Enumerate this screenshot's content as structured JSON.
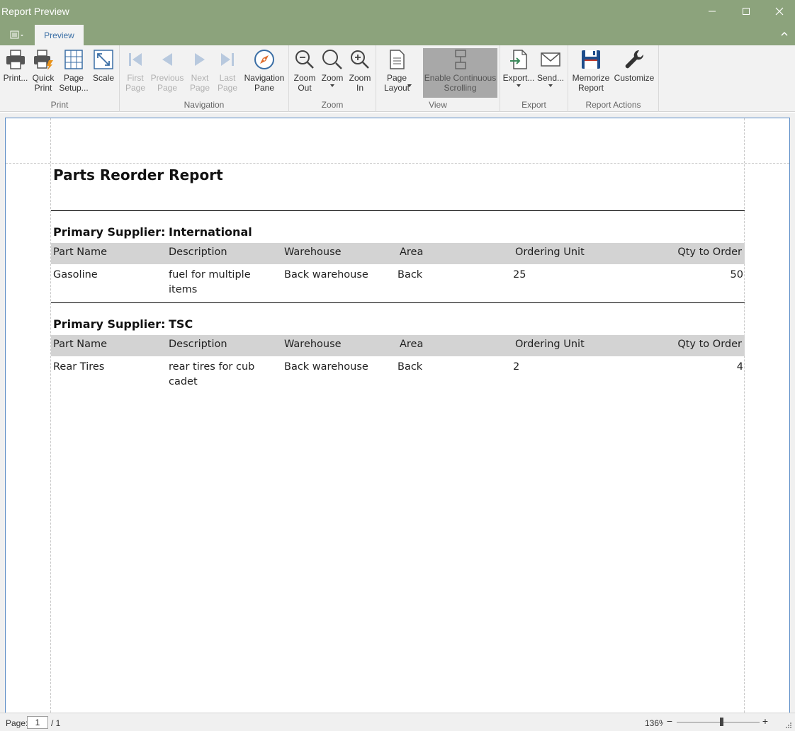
{
  "window": {
    "title": "Report Preview"
  },
  "tabs": {
    "preview": "Preview"
  },
  "ribbon": {
    "groups": {
      "print": "Print",
      "navigation": "Navigation",
      "zoom": "Zoom",
      "view": "View",
      "export": "Export",
      "report_actions": "Report Actions"
    },
    "buttons": {
      "print": "Print...",
      "quick_print": "Quick\nPrint",
      "page_setup": "Page\nSetup...",
      "scale": "Scale",
      "first_page": "First\nPage",
      "previous_page": "Previous\nPage",
      "next_page": "Next\nPage",
      "last_page": "Last\nPage",
      "navigation_pane": "Navigation\nPane",
      "zoom_out": "Zoom\nOut",
      "zoom": "Zoom",
      "zoom_in": "Zoom\nIn",
      "page_layout": "Page\nLayout",
      "continuous_scrolling": "Enable Continuous\nScrolling",
      "export": "Export...",
      "send": "Send...",
      "memorize_report": "Memorize\nReport",
      "customize": "Customize"
    },
    "icons": {
      "print": "printer-icon",
      "quick_print": "quick-print-icon",
      "page_setup": "page-setup-grid-icon",
      "scale": "scale-arrows-icon",
      "first_page": "first-page-icon",
      "previous_page": "previous-page-icon",
      "next_page": "next-page-icon",
      "last_page": "last-page-icon",
      "navigation_pane": "compass-icon",
      "zoom_out": "zoom-out-icon",
      "zoom": "magnifier-icon",
      "zoom_in": "zoom-in-icon",
      "page_layout": "page-layout-icon",
      "continuous_scrolling": "continuous-scrolling-icon",
      "export": "export-document-icon",
      "send": "envelope-icon",
      "memorize_report": "floppy-disk-icon",
      "customize": "wrench-icon"
    }
  },
  "report": {
    "title": "Parts Reorder Report",
    "supplier_label": "Primary Supplier:",
    "columns": [
      "Part Name",
      "Description",
      "Warehouse",
      "Area",
      "Ordering Unit",
      "Qty to Order"
    ],
    "groups": [
      {
        "supplier": "International",
        "rows": [
          {
            "part_name": "Gasoline",
            "description_l1": "fuel for multiple",
            "description_l2": "items",
            "warehouse": "Back warehouse",
            "area": "Back",
            "ordering_unit": "25",
            "qty": "50"
          }
        ]
      },
      {
        "supplier": "TSC",
        "rows": [
          {
            "part_name": "Rear Tires",
            "description_l1": "rear tires for cub",
            "description_l2": "cadet",
            "warehouse": "Back warehouse",
            "area": "Back",
            "ordering_unit": "2",
            "qty": "4"
          }
        ]
      }
    ]
  },
  "status": {
    "page_label": "Page:",
    "page_value": "1",
    "page_total": "/ 1",
    "zoom_value": "136%",
    "zoom_fraction": 0.54
  },
  "colors": {
    "titlebar": "#8ca37c",
    "tab_text": "#3a6ea5",
    "active_button": "#a8a8a8",
    "page_border": "#5a8bc6",
    "column_header_bg": "#d3d3d3",
    "floppy": "#1f4e8c"
  }
}
